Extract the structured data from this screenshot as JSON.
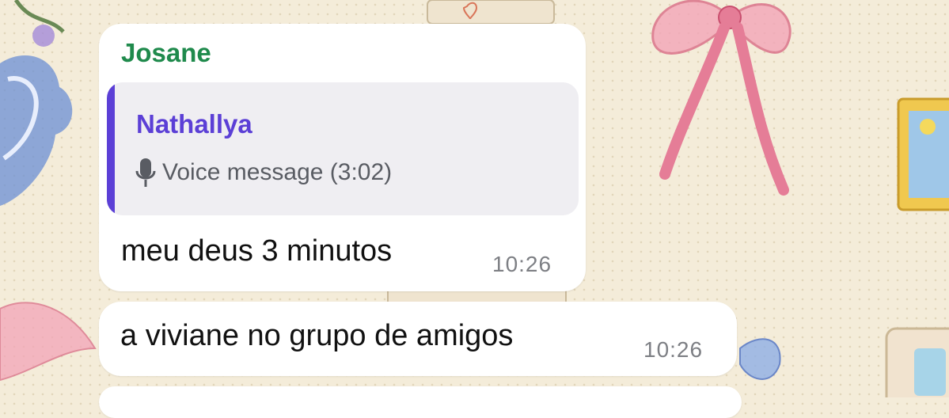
{
  "messages": [
    {
      "sender": "Josane",
      "reply": {
        "author": "Nathallya",
        "icon": "microphone-icon",
        "text": "Voice message (3:02)"
      },
      "text": "meu deus 3 minutos",
      "time": "10:26"
    },
    {
      "text": "a viviane no grupo de amigos",
      "time": "10:26"
    }
  ],
  "colors": {
    "sender_name": "#1f8a4c",
    "reply_author": "#5b3fd6",
    "reply_bar": "#5b3fd6",
    "bubble": "#ffffff",
    "wallpaper": "#f4ecd9"
  }
}
